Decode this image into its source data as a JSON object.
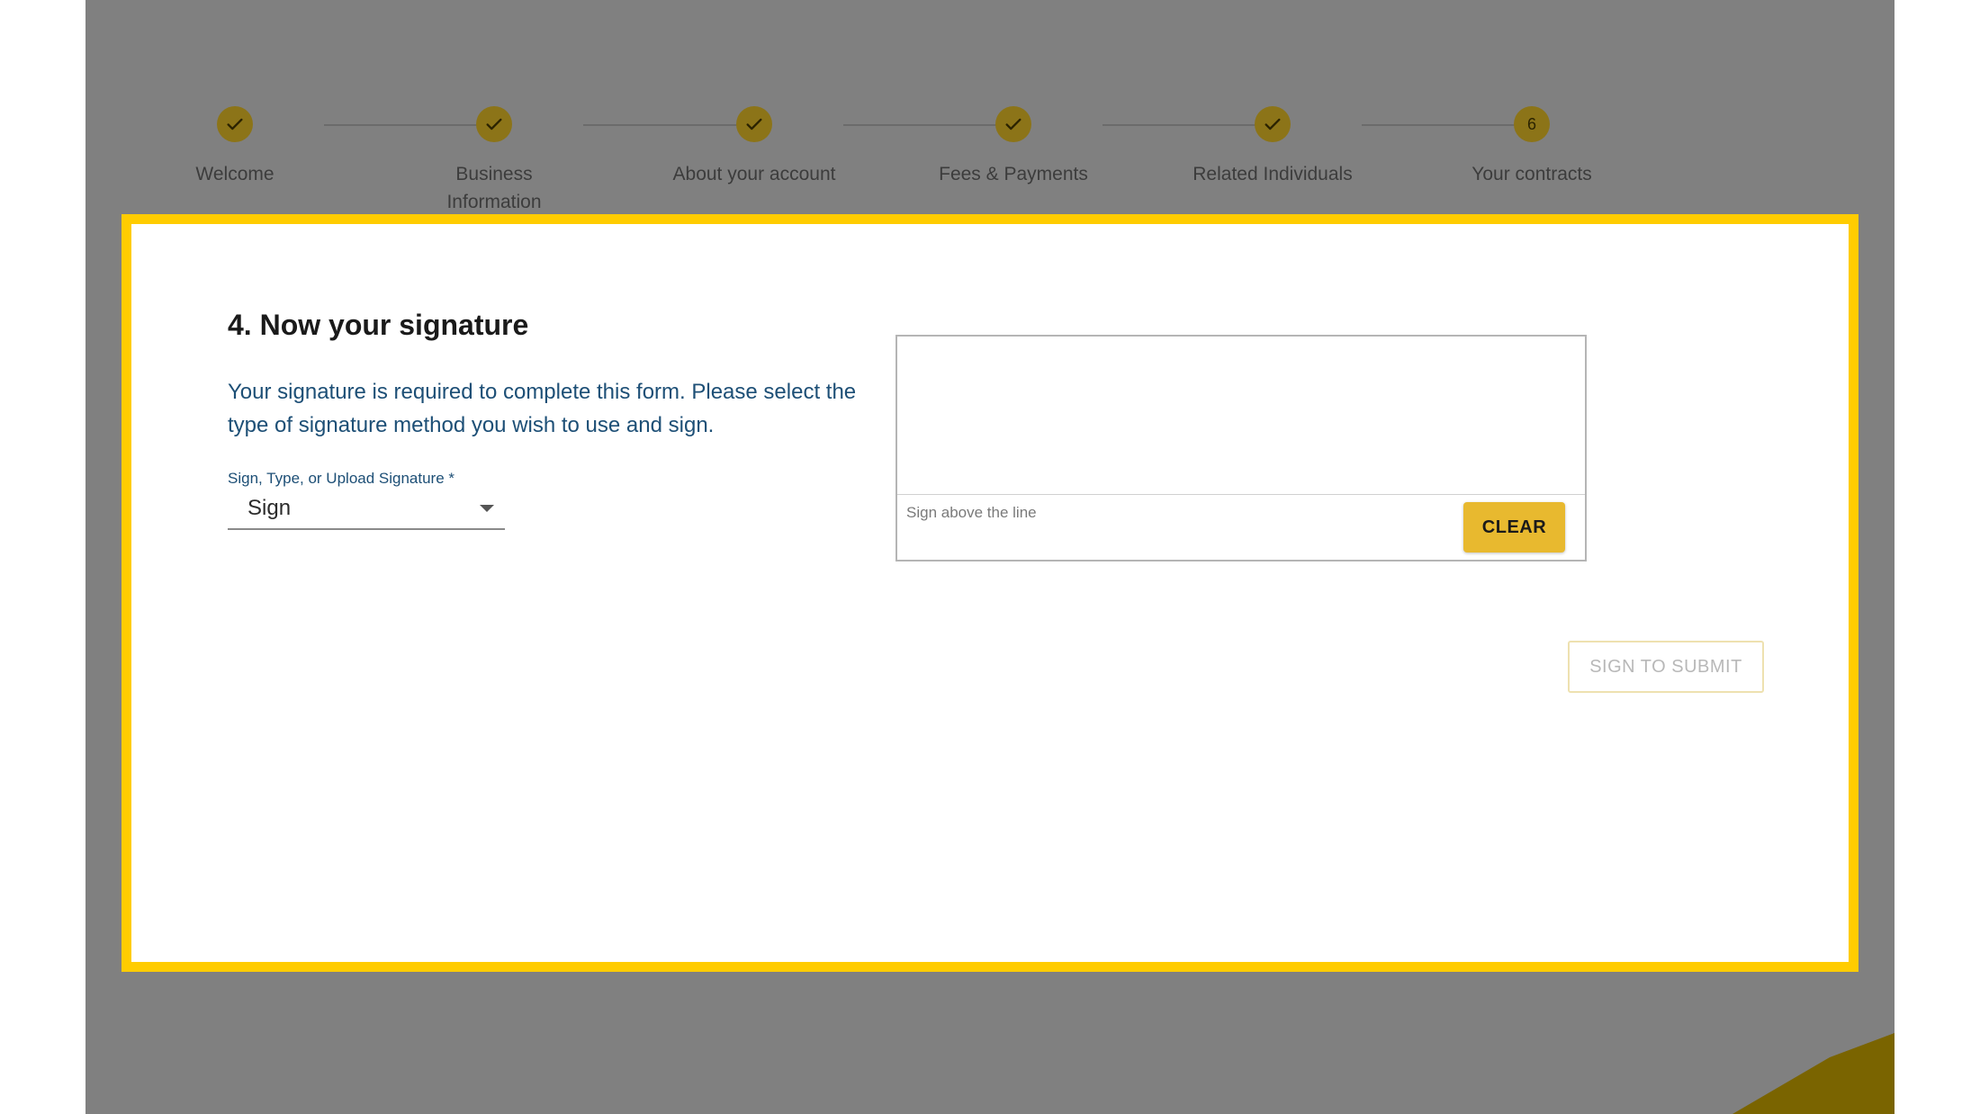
{
  "colors": {
    "accent": "#ffcc00",
    "button_gold": "#e8b92f",
    "step_circle": "#8c7418",
    "overlay": "#808080",
    "link_blue": "#1d4f76"
  },
  "stepper": {
    "steps": [
      {
        "label": "Welcome",
        "state": "complete",
        "icon": "check-icon"
      },
      {
        "label": "Business Information",
        "state": "complete",
        "icon": "check-icon"
      },
      {
        "label": "About your account",
        "state": "complete",
        "icon": "check-icon"
      },
      {
        "label": "Fees & Payments",
        "state": "complete",
        "icon": "check-icon"
      },
      {
        "label": "Related Individuals",
        "state": "complete",
        "icon": "check-icon"
      },
      {
        "label": "Your contracts",
        "state": "current",
        "number": "6"
      }
    ]
  },
  "signature_section": {
    "title": "4. Now your signature",
    "description": "Your signature is required to complete this form. Please select the type of signature method you wish to use and sign.",
    "method_label": "Sign, Type, or Upload Signature *",
    "method_value": "Sign",
    "pad_hint": "Sign above the line",
    "clear_label": "CLEAR",
    "submit_label": "SIGN TO SUBMIT"
  }
}
